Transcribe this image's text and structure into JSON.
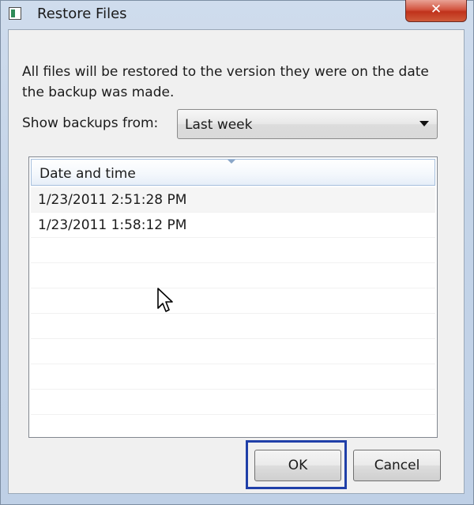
{
  "window": {
    "title": "Restore Files",
    "close_label": "✕",
    "icons": {
      "app": "restore-files-app-icon",
      "close": "close-icon"
    }
  },
  "dialog": {
    "description": "All files will be restored to the version they were on the date the backup was made.",
    "show_backups_label": "Show backups from:",
    "dropdown": {
      "selected": "Last week",
      "icon": "chevron-down-icon"
    },
    "list": {
      "column_header": "Date and time",
      "rows": [
        "1/23/2011 2:51:28 PM",
        "1/23/2011 1:58:12 PM",
        "",
        "",
        "",
        "",
        "",
        "",
        ""
      ]
    },
    "buttons": {
      "ok": "OK",
      "cancel": "Cancel"
    }
  },
  "colors": {
    "highlight": "#1f3fa8",
    "close_button": "#c0321b"
  }
}
